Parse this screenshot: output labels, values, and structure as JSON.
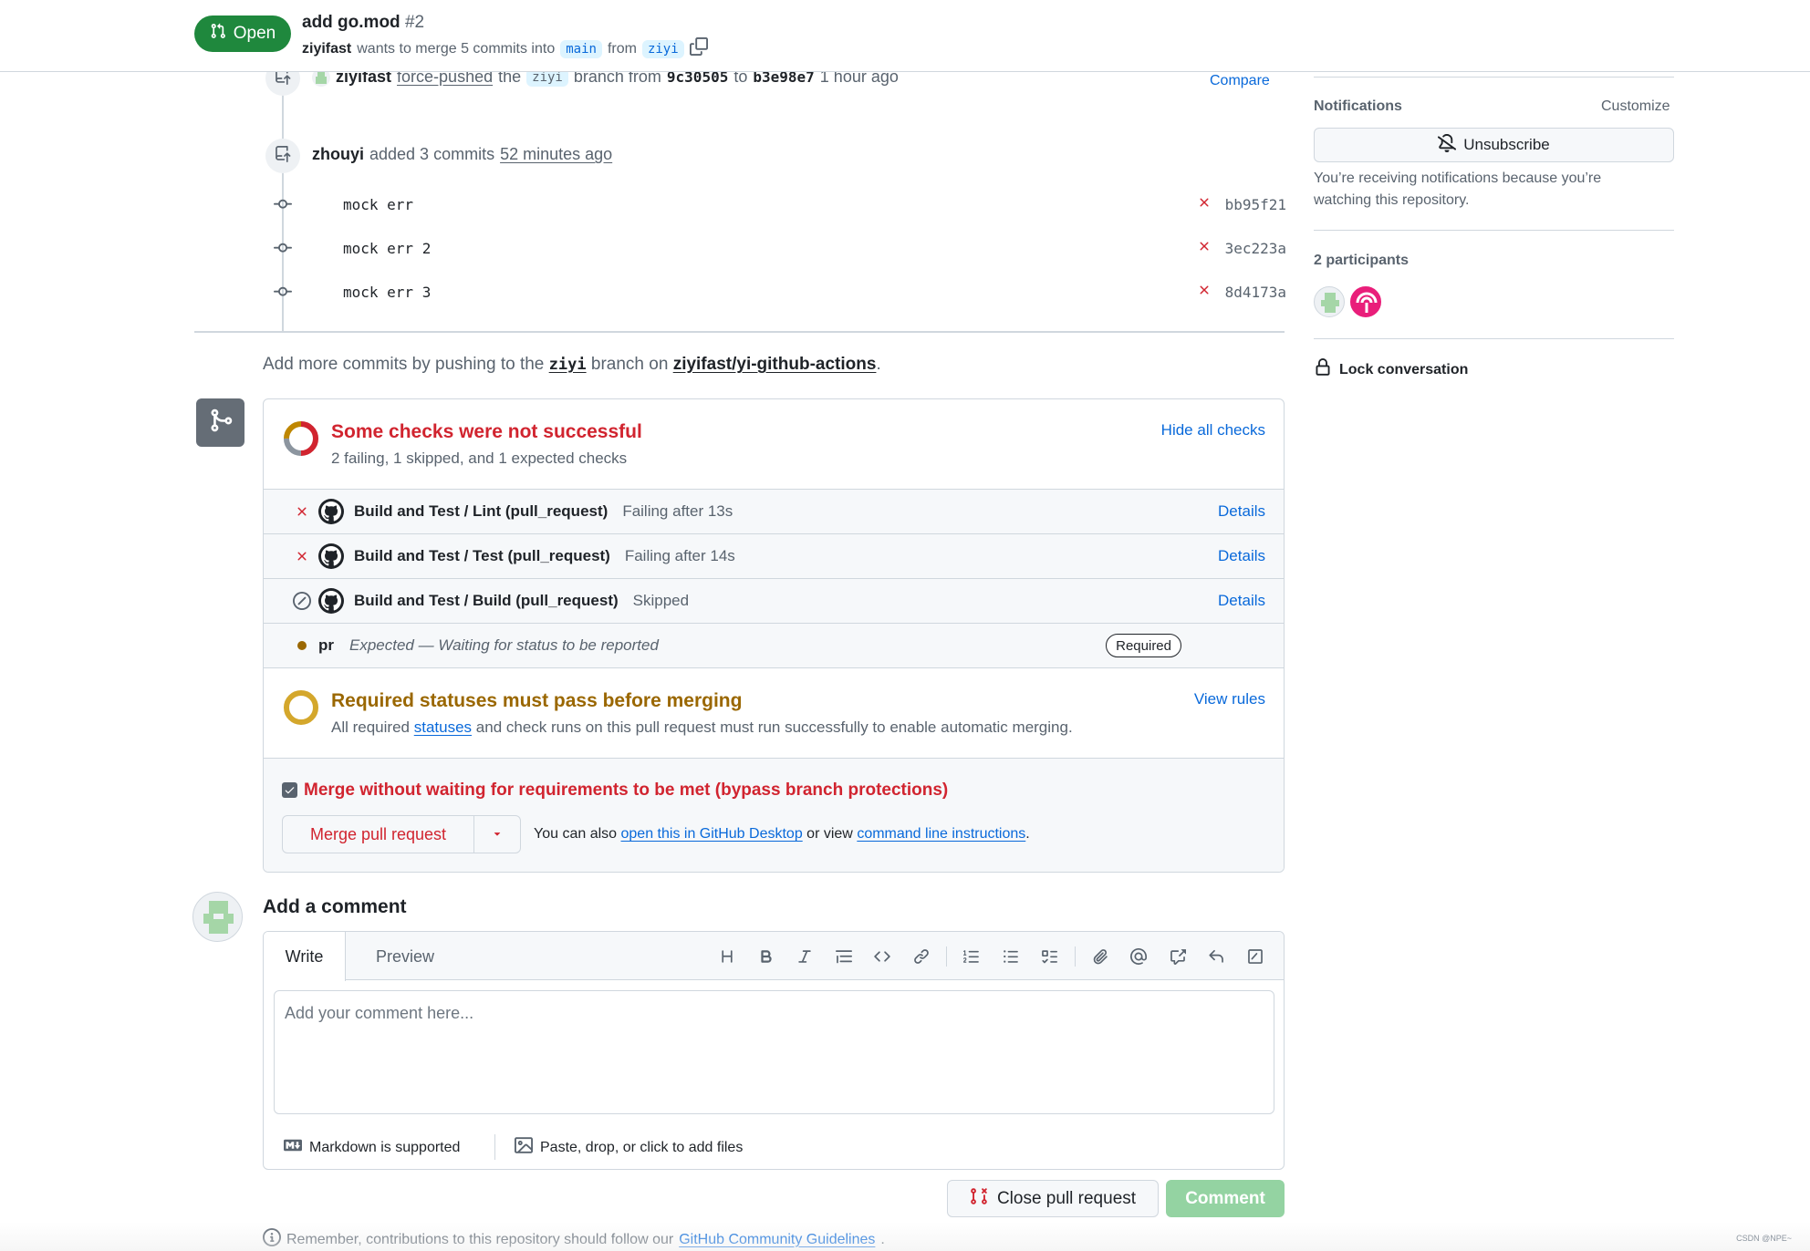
{
  "header": {
    "state": "Open",
    "title": "add go.mod",
    "number": "#2",
    "author": "ziyifast",
    "merge_text": "wants to merge 5 commits into",
    "base_branch": "main",
    "from_text": "from",
    "head_branch": "ziyi"
  },
  "timeline": {
    "force_push": {
      "user": "ziyifast",
      "action": "force-pushed",
      "the": "the",
      "branch": "ziyi",
      "branch_from": "branch from",
      "from_sha": "9c30505",
      "to": "to",
      "to_sha": "b3e98e7",
      "time": "1 hour ago",
      "compare_label": "Compare"
    },
    "commit_event": {
      "user": "zhouyi",
      "action": "added 3 commits",
      "time": "52 minutes ago"
    },
    "commits": [
      {
        "message": "mock err",
        "sha": "bb95f21",
        "status": "failed"
      },
      {
        "message": "mock err 2",
        "sha": "3ec223a",
        "status": "failed"
      },
      {
        "message": "mock err 3",
        "sha": "8d4173a",
        "status": "failed"
      }
    ],
    "more_commits": {
      "prefix": "Add more commits by pushing to the",
      "branch": "ziyi",
      "middle": "branch on",
      "repo": "ziyifast/yi-github-actions",
      "suffix": "."
    }
  },
  "merge_box": {
    "checks_title": "Some checks were not successful",
    "checks_summary": "2 failing, 1 skipped, and 1 expected checks",
    "hide_checks_label": "Hide all checks",
    "checks": [
      {
        "name": "Build and Test / Lint (pull_request)",
        "description": "Failing after 13s",
        "status": "failed",
        "details_label": "Details"
      },
      {
        "name": "Build and Test / Test (pull_request)",
        "description": "Failing after 14s",
        "status": "failed",
        "details_label": "Details"
      },
      {
        "name": "Build and Test / Build (pull_request)",
        "description": "Skipped",
        "status": "skipped",
        "details_label": "Details"
      }
    ],
    "expected_check": {
      "name": "pr",
      "description": "Expected — Waiting for status to be reported",
      "required_label": "Required"
    },
    "required_title": "Required statuses must pass before merging",
    "required_sub_prefix": "All required",
    "required_sub_link": "statuses",
    "required_sub_suffix": "and check runs on this pull request must run successfully to enable automatic merging.",
    "view_rules_label": "View rules",
    "bypass_label": "Merge without waiting for requirements to be met (bypass branch protections)",
    "bypass_checked": true,
    "merge_button_label": "Merge pull request",
    "alt_prefix": "You can also",
    "alt_link1": "open this in GitHub Desktop",
    "alt_middle": "or view",
    "alt_link2": "command line instructions",
    "alt_suffix": "."
  },
  "comment": {
    "heading": "Add a comment",
    "tab_write": "Write",
    "tab_preview": "Preview",
    "placeholder": "Add your comment here...",
    "markdown_note": "Markdown is supported",
    "attach_note": "Paste, drop, or click to add files",
    "close_button": "Close pull request",
    "comment_button": "Comment",
    "guidelines_prefix": "Remember, contributions to this repository should follow our",
    "guidelines_link": "GitHub Community Guidelines",
    "guidelines_suffix": "."
  },
  "sidebar": {
    "notifications_label": "Notifications",
    "customize_label": "Customize",
    "unsubscribe_label": "Unsubscribe",
    "notif_reason": "You’re receiving notifications because you’re watching this repository.",
    "participants_label": "2 participants",
    "lock_label": "Lock conversation"
  },
  "watermark": "CSDN @NPE~",
  "colors": {
    "open_green": "#1f883d",
    "danger_red": "#d1242f",
    "attention_yellow": "#9a6700",
    "link_blue": "#0969da",
    "comment_button_disabled": "#94d3a2"
  }
}
